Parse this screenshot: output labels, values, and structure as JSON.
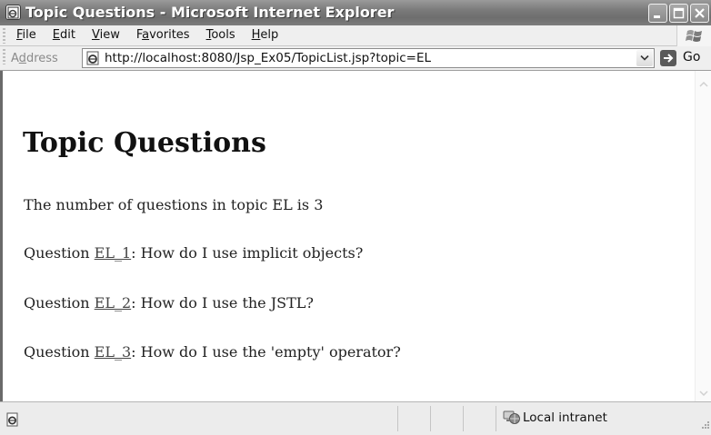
{
  "window": {
    "title": "Topic Questions - Microsoft Internet Explorer"
  },
  "menubar": {
    "items": [
      {
        "label": "File",
        "accel": "F",
        "rest": "ile"
      },
      {
        "label": "Edit",
        "accel": "E",
        "rest": "dit"
      },
      {
        "label": "View",
        "accel": "V",
        "rest": "iew"
      },
      {
        "label": "Favorites",
        "pre": "F",
        "accel": "a",
        "rest": "vorites"
      },
      {
        "label": "Tools",
        "accel": "T",
        "rest": "ools"
      },
      {
        "label": "Help",
        "accel": "H",
        "rest": "elp"
      }
    ]
  },
  "addressbar": {
    "label_pre": "A",
    "label_accel": "d",
    "label_rest": "dress",
    "url": "http://localhost:8080/Jsp_Ex05/TopicList.jsp?topic=EL",
    "go_label": "Go"
  },
  "page": {
    "heading": "Topic Questions",
    "summary": "The number of questions in topic EL is 3",
    "question_prefix": "Question ",
    "questions": [
      {
        "id": "EL_1",
        "text": ": How do I use implicit objects?"
      },
      {
        "id": "EL_2",
        "text": ": How do I use the JSTL?"
      },
      {
        "id": "EL_3",
        "text": ": How do I use the 'empty' operator?"
      }
    ]
  },
  "statusbar": {
    "zone": "Local intranet"
  },
  "icons": {
    "title": "ie-page-icon",
    "address": "ie-page-icon",
    "go": "go-arrow-icon",
    "status": "page-done-icon",
    "zone": "local-intranet-icon",
    "throbber": "windows-logo-icon"
  },
  "colors": {
    "titlebar": "#7a7a7a",
    "content_bg": "#ffffff",
    "link": "#444444"
  }
}
